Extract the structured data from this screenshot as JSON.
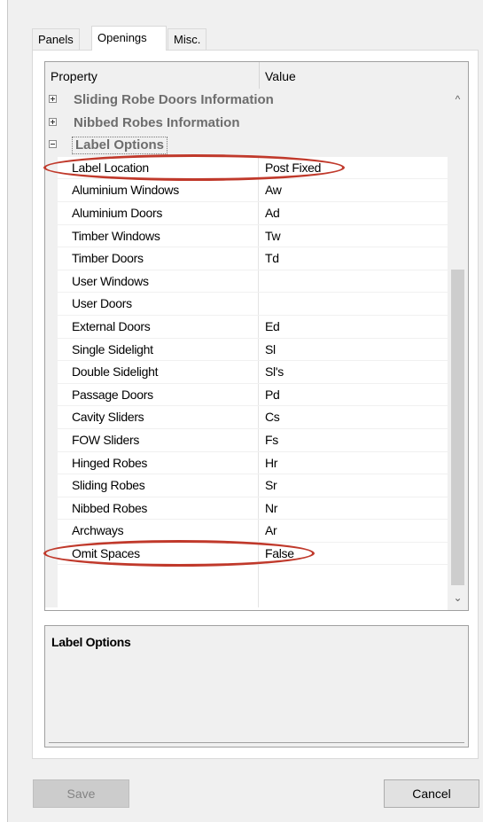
{
  "tabs": [
    {
      "label": "Panels",
      "active": false
    },
    {
      "label": "Openings",
      "active": true
    },
    {
      "label": "Misc.",
      "active": false
    }
  ],
  "grid": {
    "columns": {
      "property": "Property",
      "value": "Value"
    },
    "categories": [
      {
        "label": "Sliding Robe Doors Information",
        "expanded": false
      },
      {
        "label": "Nibbed Robes Information",
        "expanded": false
      },
      {
        "label": "Label Options",
        "expanded": true
      }
    ],
    "rows": [
      {
        "property": "Label Location",
        "value": "Post Fixed"
      },
      {
        "property": "Aluminium Windows",
        "value": "Aw"
      },
      {
        "property": "Aluminium Doors",
        "value": "Ad"
      },
      {
        "property": "Timber Windows",
        "value": "Tw"
      },
      {
        "property": "Timber Doors",
        "value": "Td"
      },
      {
        "property": "User Windows",
        "value": ""
      },
      {
        "property": "User Doors",
        "value": ""
      },
      {
        "property": "External Doors",
        "value": "Ed"
      },
      {
        "property": "Single Sidelight",
        "value": "Sl"
      },
      {
        "property": "Double Sidelight",
        "value": "Sl's"
      },
      {
        "property": "Passage Doors",
        "value": "Pd"
      },
      {
        "property": "Cavity Sliders",
        "value": "Cs"
      },
      {
        "property": "FOW Sliders",
        "value": "Fs"
      },
      {
        "property": "Hinged Robes",
        "value": "Hr"
      },
      {
        "property": "Sliding Robes",
        "value": "Sr"
      },
      {
        "property": "Nibbed Robes",
        "value": "Nr"
      },
      {
        "property": "Archways",
        "value": "Ar"
      },
      {
        "property": "Omit Spaces",
        "value": "False"
      }
    ]
  },
  "scrollbar": {
    "up_icon": "chevron-up-icon",
    "down_icon": "chevron-down-icon",
    "up_glyph": "^",
    "down_glyph": "⌄"
  },
  "description": {
    "title": "Label Options"
  },
  "buttons": {
    "save": "Save",
    "save_enabled": false,
    "cancel": "Cancel"
  },
  "annotation_color": "#c0392b"
}
